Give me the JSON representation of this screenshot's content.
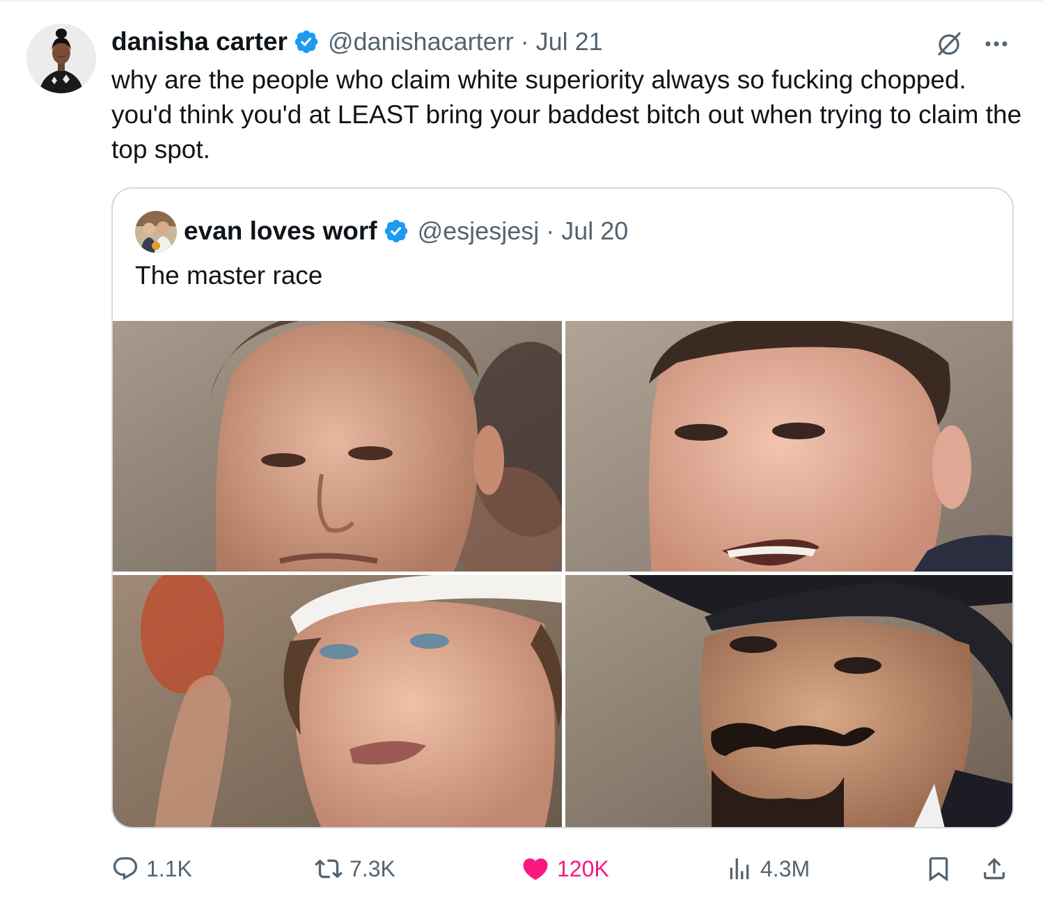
{
  "tweet": {
    "author": {
      "display_name": "danisha carter",
      "handle": "@danishacarterr",
      "verified": true
    },
    "separator": "·",
    "timestamp": "Jul 21",
    "text": "why are the people who claim white superiority always so fucking chopped. you'd think you'd at LEAST bring your baddest bitch out when trying to claim the top spot.",
    "quoted_tweet": {
      "author": {
        "display_name": "evan loves worf",
        "handle": "@esjesjesj",
        "verified": true
      },
      "separator": "·",
      "timestamp": "Jul 20",
      "text": "The master race",
      "media_count": 4
    },
    "metrics": {
      "replies": "1.1K",
      "reposts": "7.3K",
      "likes": "120K",
      "views": "4.3M"
    }
  },
  "icons": {
    "verified": "verified-badge-icon",
    "grok": "grok-icon",
    "more": "more-icon",
    "reply": "reply-icon",
    "repost": "repost-icon",
    "like": "heart-icon",
    "views": "views-icon",
    "bookmark": "bookmark-icon",
    "share": "share-icon"
  },
  "colors": {
    "verified_blue": "#1d9bf0",
    "like_pink": "#f91880",
    "text": "#0f1419",
    "muted": "#536471",
    "border": "#cfd9de"
  }
}
